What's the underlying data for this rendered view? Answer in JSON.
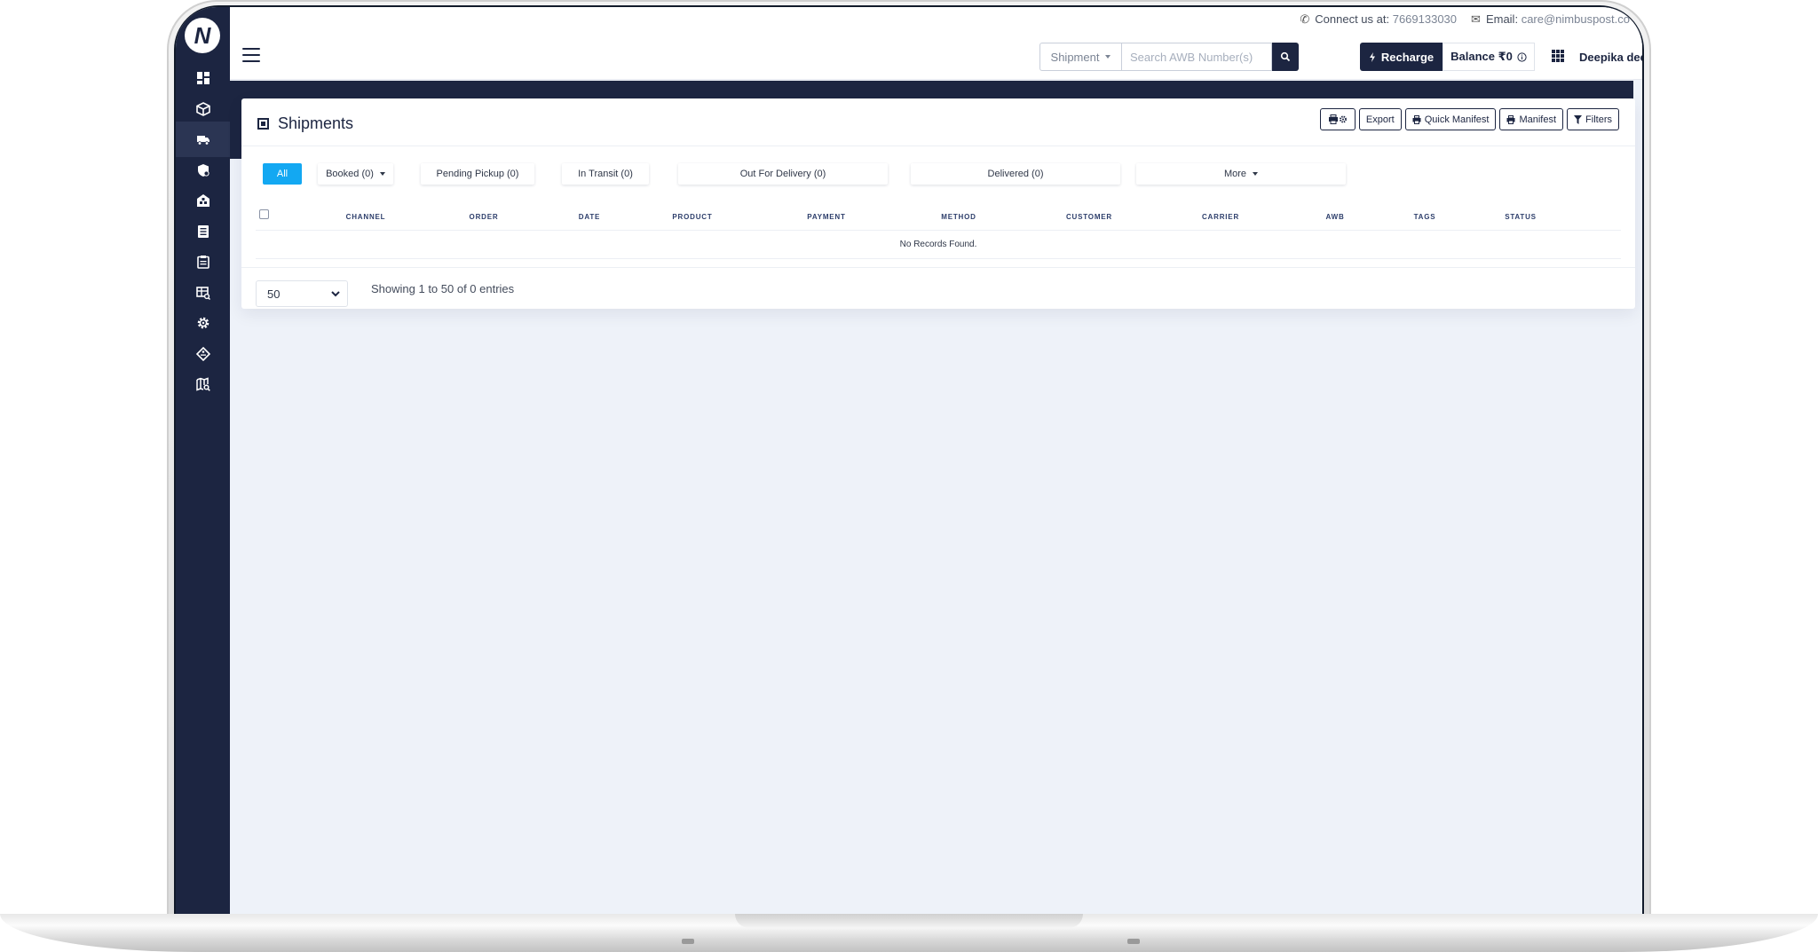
{
  "contact": {
    "connect_label": "Connect us at:",
    "phone": "7669133030",
    "email_label": "Email:",
    "email": "care@nimbuspost.co"
  },
  "logo_letter": "N",
  "sidebar": {
    "items": [
      {
        "icon": "dashboard-icon"
      },
      {
        "icon": "box-icon"
      },
      {
        "icon": "truck-icon",
        "active": true
      },
      {
        "icon": "shield-icon"
      },
      {
        "icon": "warehouse-icon"
      },
      {
        "icon": "document-icon"
      },
      {
        "icon": "clipboard-icon"
      },
      {
        "icon": "table-search-icon"
      },
      {
        "icon": "gear-icon"
      },
      {
        "icon": "tag-icon"
      },
      {
        "icon": "map-search-icon"
      }
    ]
  },
  "header": {
    "search_type": "Shipment",
    "search_placeholder": "Search AWB Number(s)",
    "recharge_label": "Recharge",
    "balance_label": "Balance ₹0",
    "user_name": "Deepika deepika"
  },
  "card": {
    "title": "Shipments",
    "toolbar": {
      "export_label": "Export",
      "quick_manifest_label": "Quick Manifest",
      "manifest_label": "Manifest",
      "filters_label": "Filters"
    },
    "tabs": [
      {
        "label": "All",
        "active": true
      },
      {
        "label": "Booked (0)",
        "dropdown": true
      },
      {
        "label": "Pending Pickup (0)"
      },
      {
        "label": "In Transit (0)"
      },
      {
        "label": "Out For Delivery (0)"
      },
      {
        "label": "Delivered (0)"
      },
      {
        "label": "More",
        "dropdown": true
      }
    ],
    "columns": [
      "CHANNEL",
      "ORDER",
      "DATE",
      "PRODUCT",
      "PAYMENT",
      "METHOD",
      "CUSTOMER",
      "CARRIER",
      "AWB",
      "TAGS",
      "STATUS"
    ],
    "empty_message": "No Records Found.",
    "page_size": "50",
    "entries_text": "Showing 1 to 50 of 0 entries"
  },
  "colors": {
    "navy": "#1c2541",
    "accent_blue": "#13a8f2",
    "content_bg": "#eef2f9"
  }
}
